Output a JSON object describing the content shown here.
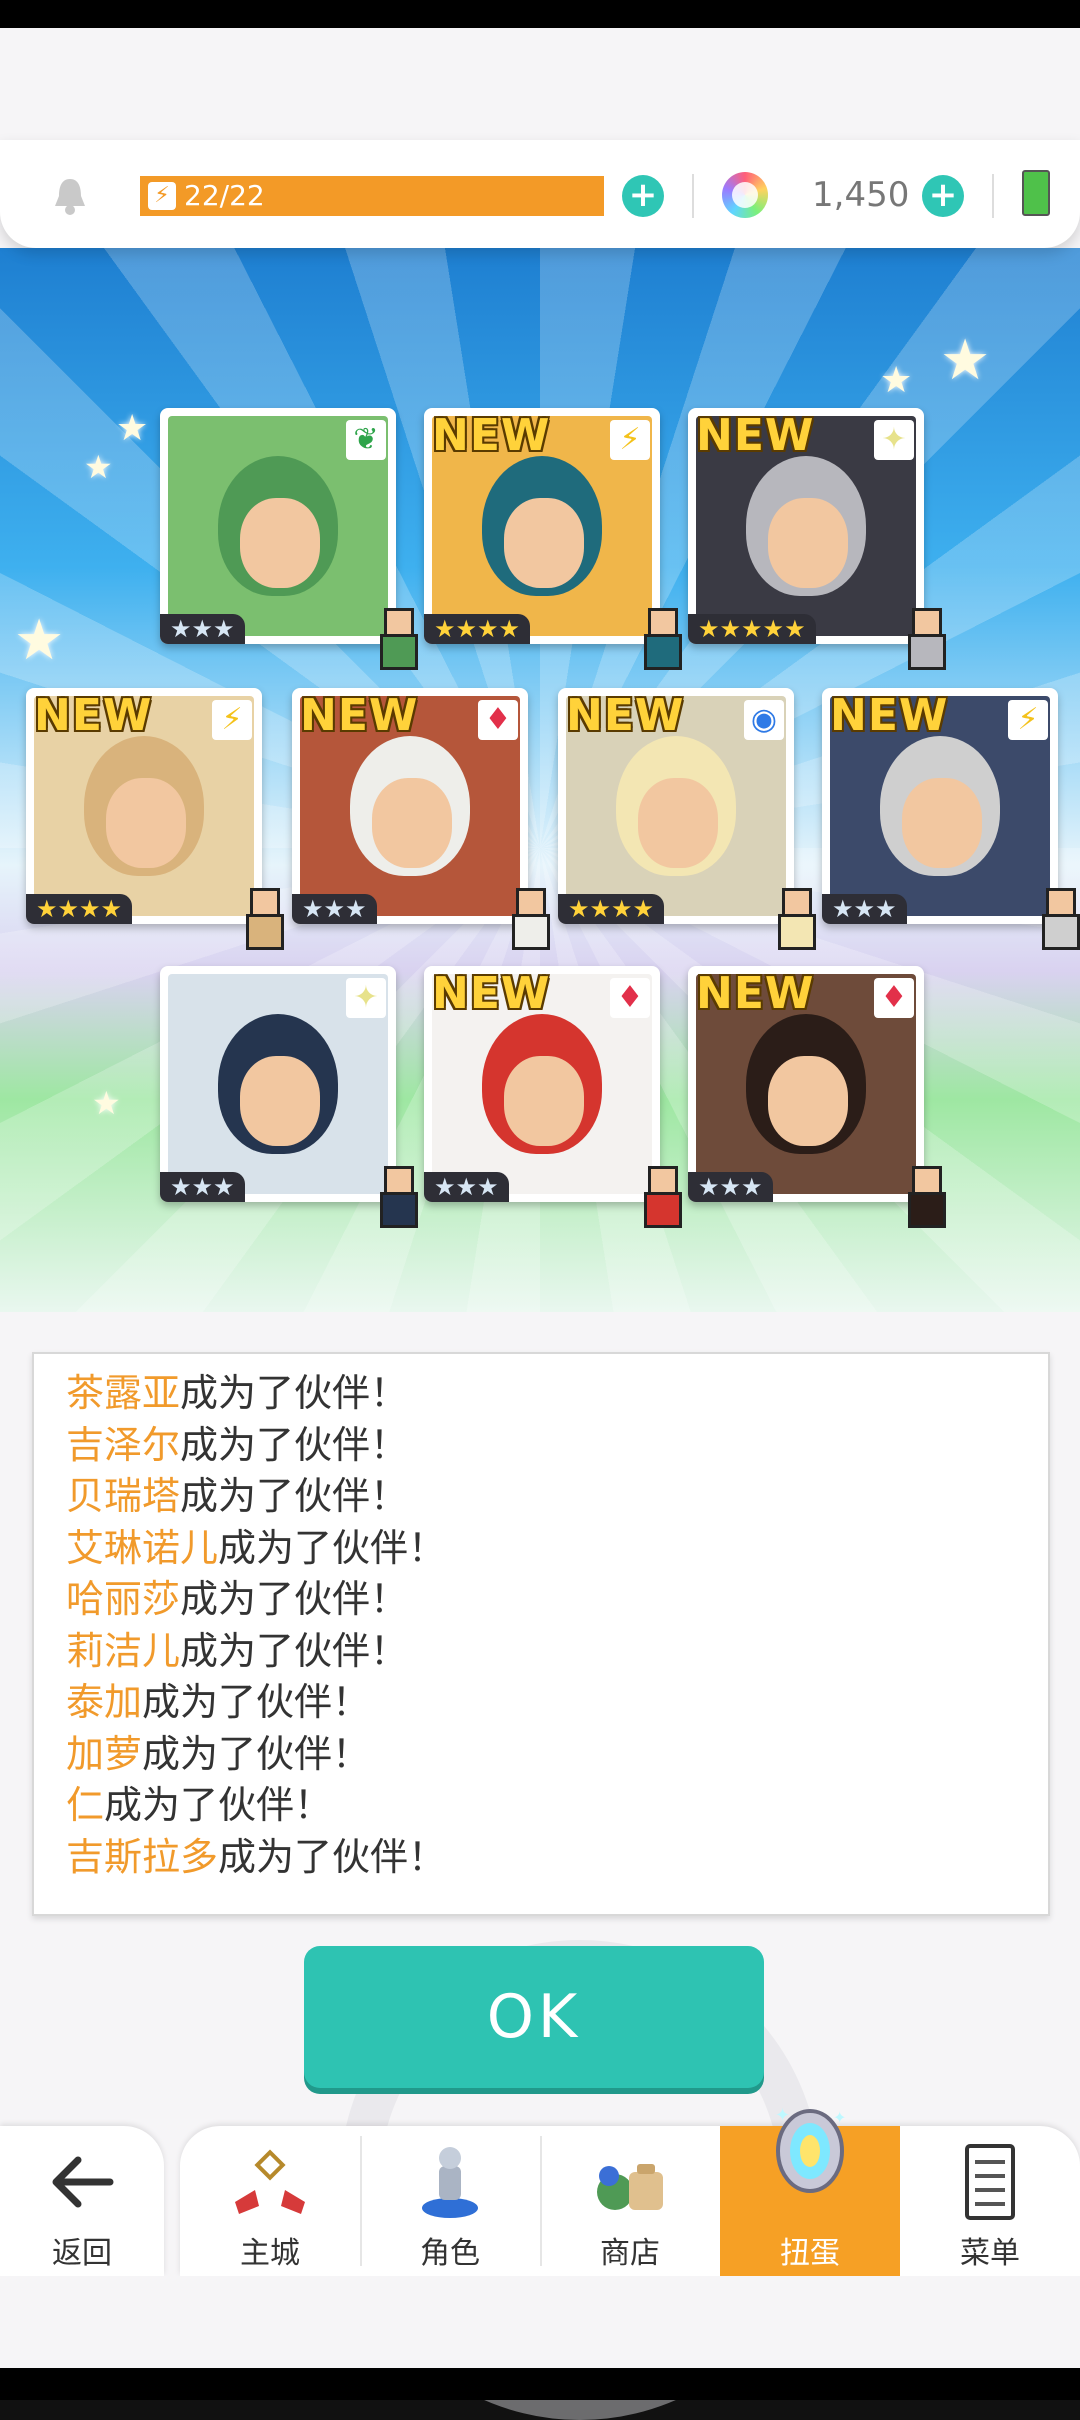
{
  "topbar": {
    "stamina": "22/22",
    "gems": "1,450"
  },
  "cards": [
    {
      "new": "",
      "element": "leaf",
      "element_glyph": "❦",
      "element_color": "#2ea44a",
      "stars": "★★★",
      "hair": "#4f9a55",
      "bg": "#7bbf6f"
    },
    {
      "new": "NEW",
      "element": "lightning",
      "element_glyph": "⚡",
      "element_color": "#f4c21b",
      "stars": "★★★★",
      "hair": "#1f6b7c",
      "bg": "#f0b64a"
    },
    {
      "new": "NEW",
      "element": "light",
      "element_glyph": "✦",
      "element_color": "#e7e28b",
      "stars": "★★★★★",
      "hair": "#b7b7bd",
      "bg": "#3a3a44"
    },
    {
      "new": "NEW",
      "element": "lightning",
      "element_glyph": "⚡",
      "element_color": "#f4c21b",
      "stars": "★★★★",
      "hair": "#d9b37c",
      "bg": "#e8d2a5"
    },
    {
      "new": "NEW",
      "element": "fire",
      "element_glyph": "♦",
      "element_color": "#e2304a",
      "stars": "★★★",
      "hair": "#eeeeea",
      "bg": "#b5563a"
    },
    {
      "new": "NEW",
      "element": "water",
      "element_glyph": "◉",
      "element_color": "#2f7ae6",
      "stars": "★★★★",
      "hair": "#f3e6b3",
      "bg": "#d9d2b8"
    },
    {
      "new": "NEW",
      "element": "lightning",
      "element_glyph": "⚡",
      "element_color": "#f4c21b",
      "stars": "★★★",
      "hair": "#cfcfcf",
      "bg": "#3c4a6a"
    },
    {
      "new": "",
      "element": "light",
      "element_glyph": "✦",
      "element_color": "#e7e28b",
      "stars": "★★★",
      "hair": "#25354f",
      "bg": "#d8e2ea"
    },
    {
      "new": "NEW",
      "element": "fire",
      "element_glyph": "♦",
      "element_color": "#e2304a",
      "stars": "★★★",
      "hair": "#d5352e",
      "bg": "#f4f2f0"
    },
    {
      "new": "NEW",
      "element": "fire",
      "element_glyph": "♦",
      "element_color": "#e2304a",
      "stars": "★★★",
      "hair": "#2b1d18",
      "bg": "#6e4b3a"
    }
  ],
  "messages": [
    {
      "name": "茶露亚",
      "suffix": "成为了伙伴！"
    },
    {
      "name": "吉泽尔",
      "suffix": "成为了伙伴！"
    },
    {
      "name": "贝瑞塔",
      "suffix": "成为了伙伴！"
    },
    {
      "name": "艾琳诺儿",
      "suffix": "成为了伙伴！"
    },
    {
      "name": "哈丽莎",
      "suffix": "成为了伙伴！"
    },
    {
      "name": "莉洁儿",
      "suffix": "成为了伙伴！"
    },
    {
      "name": "泰加",
      "suffix": "成为了伙伴！"
    },
    {
      "name": "加萝",
      "suffix": "成为了伙伴！"
    },
    {
      "name": "仁",
      "suffix": "成为了伙伴！"
    },
    {
      "name": "吉斯拉多",
      "suffix": "成为了伙伴！"
    }
  ],
  "ok_label": "OK",
  "nav": {
    "back": "返回",
    "items": [
      "主城",
      "角色",
      "商店",
      "扭蛋",
      "菜单"
    ],
    "active": "扭蛋"
  }
}
